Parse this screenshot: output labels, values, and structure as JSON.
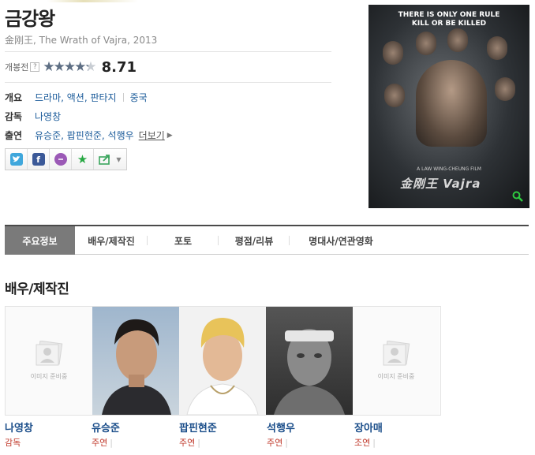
{
  "movie": {
    "title": "금강왕",
    "subtitle": "金刚王, The Wrath of Vajra, 2013",
    "rating_label": "개봉전",
    "help": "?",
    "star_rating": 4.355,
    "stars_full": "★★★★",
    "stars_half": "★",
    "score": "8.71"
  },
  "info": {
    "overview_label": "개요",
    "genres": "드라마, 액션, 판타지",
    "country": "중국",
    "director_label": "감독",
    "director": "나영창",
    "cast_label": "출연",
    "cast": "유승준, 팝핀현준, 석행우",
    "more": "더보기"
  },
  "share": {
    "icons": [
      "twitter-icon",
      "facebook-icon",
      "chat-icon",
      "favorite-star-icon",
      "share-export-icon"
    ]
  },
  "poster": {
    "tagline_1": "THERE IS ONLY ONE RULE",
    "tagline_2": "KILL OR BE KILLED",
    "credit": "A LAW WING-CHEUNG FILM",
    "logo": "金刚王 Vajra",
    "search_icon": "search-icon"
  },
  "tabs": [
    {
      "label": "주요정보",
      "active": true
    },
    {
      "label": "배우/제작진",
      "active": false
    },
    {
      "label": "포토",
      "active": false
    },
    {
      "label": "평점/리뷰",
      "active": false
    },
    {
      "label": "명대사/연관영화",
      "active": false
    }
  ],
  "section": {
    "title": "배우/제작진"
  },
  "people": [
    {
      "name": "나영창",
      "role": "감독",
      "has_photo": false,
      "placeholder": "이미지 준비중"
    },
    {
      "name": "유승준",
      "role": "주연",
      "has_photo": true
    },
    {
      "name": "팝핀현준",
      "role": "주연",
      "has_photo": true
    },
    {
      "name": "석행우",
      "role": "주연",
      "has_photo": true
    },
    {
      "name": "장아매",
      "role": "조연",
      "has_photo": false,
      "placeholder": "이미지 준비중"
    }
  ],
  "colors": {
    "link": "#1b5b9a",
    "name": "#1b4e8a",
    "role": "#c0392b",
    "active_tab": "#7a7a7a",
    "twitter": "#3fa7dc",
    "facebook": "#3b5998",
    "chat": "#9b59b6",
    "favorite": "#27a843",
    "share": "#3aa55d"
  }
}
